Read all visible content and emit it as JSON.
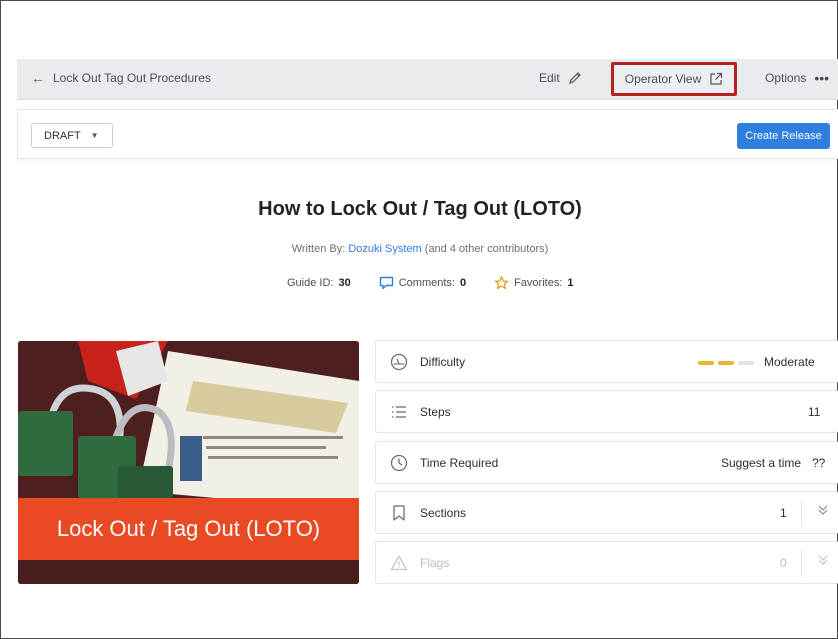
{
  "topbar": {
    "back_label": "Lock Out Tag Out Procedures",
    "edit_label": "Edit",
    "operator_view_label": "Operator View",
    "options_label": "Options",
    "options_dots": "•••"
  },
  "toolbar": {
    "draft_label": "DRAFT",
    "create_release_label": "Create Release"
  },
  "guide": {
    "title": "How to Lock Out / Tag Out (LOTO)",
    "written_by_prefix": "Written By:",
    "author": "Dozuki System",
    "contributors": "(and 4 other contributors)",
    "guide_id_label": "Guide ID:",
    "guide_id": "30",
    "comments_label": "Comments:",
    "comments": "0",
    "favorites_label": "Favorites:",
    "favorites": "1"
  },
  "cover": {
    "banner_text": "Lock Out / Tag Out (LOTO)"
  },
  "details": {
    "difficulty_label": "Difficulty",
    "difficulty_value": "Moderate",
    "difficulty_level": 2,
    "difficulty_max": 3,
    "steps_label": "Steps",
    "steps_value": "11",
    "time_label": "Time Required",
    "time_action": "Suggest a time",
    "time_value": "??",
    "sections_label": "Sections",
    "sections_value": "1",
    "flags_label": "Flags",
    "flags_value": "0"
  },
  "colors": {
    "accent_blue": "#2e7fe0",
    "highlight_red": "#b7221f",
    "difficulty_gold": "#e7b62c",
    "banner_orange": "#e84b24"
  }
}
